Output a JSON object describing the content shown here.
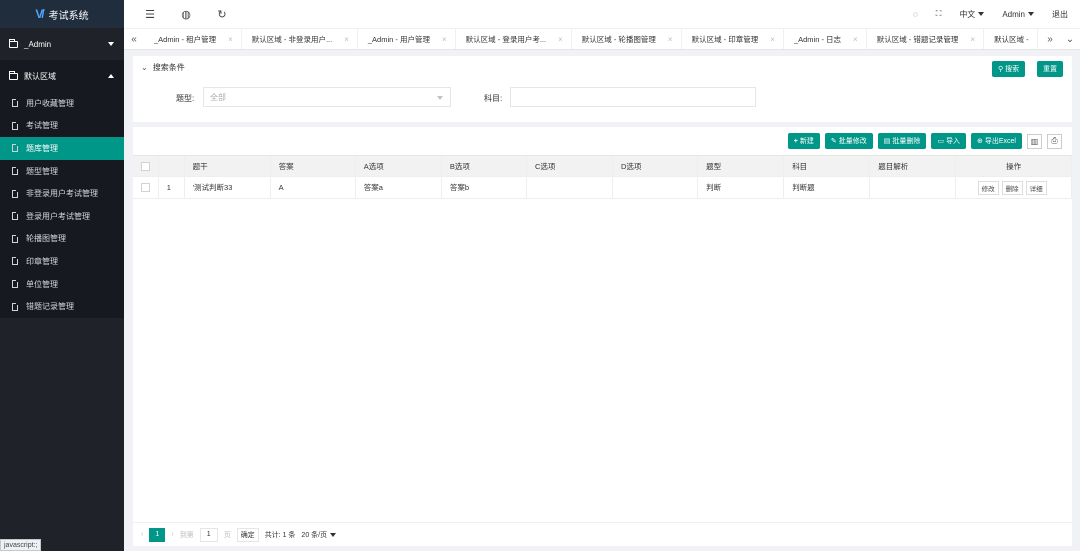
{
  "app": {
    "title": "考试系统"
  },
  "sidebar": {
    "group1": "_Admin",
    "group2": "默认区域",
    "items": [
      "用户收藏管理",
      "考试管理",
      "题库管理",
      "题型管理",
      "非登录用户考试管理",
      "登录用户考试管理",
      "轮播图管理",
      "印章管理",
      "单位管理",
      "错题记录管理"
    ],
    "active_index": 2
  },
  "topbar": {
    "lang": "中文",
    "user": "Admin",
    "logout": "退出"
  },
  "tabs": [
    "_Admin - 租户管理",
    "默认区域 - 非登录用户...",
    "_Admin - 用户管理",
    "默认区域 - 登录用户考...",
    "默认区域 - 轮播图管理",
    "默认区域 - 印章管理",
    "_Admin - 日志",
    "默认区域 - 错题记录管理",
    "默认区域 -"
  ],
  "search": {
    "title": "搜索条件",
    "search_btn": "搜索",
    "reset_btn": "重置",
    "type_label": "题型:",
    "type_value": "全部",
    "subject_label": "科目:",
    "subject_value": ""
  },
  "toolbar": {
    "new": "新建",
    "batch_edit": "批量修改",
    "batch_delete": "批量删除",
    "import": "导入",
    "export": "导出Excel"
  },
  "table": {
    "columns": [
      "题干",
      "答案",
      "A选项",
      "B选项",
      "C选项",
      "D选项",
      "题型",
      "科目",
      "题目解析",
      "操作"
    ],
    "rows": [
      {
        "index": "1",
        "stem": "'测试判断33",
        "answer": "A",
        "a": "答案a",
        "b": "答案b",
        "c": "",
        "d": "",
        "type": "判断",
        "subject": "判断题",
        "analysis": ""
      }
    ],
    "actions": [
      "修改",
      "删除",
      "详细"
    ]
  },
  "pager": {
    "current": "1",
    "goto_label": "到第",
    "goto_value": "1",
    "page_unit": "页",
    "confirm": "确定",
    "total": "共计: 1 条",
    "page_size": "20 条/页"
  },
  "status": "javascript:;"
}
